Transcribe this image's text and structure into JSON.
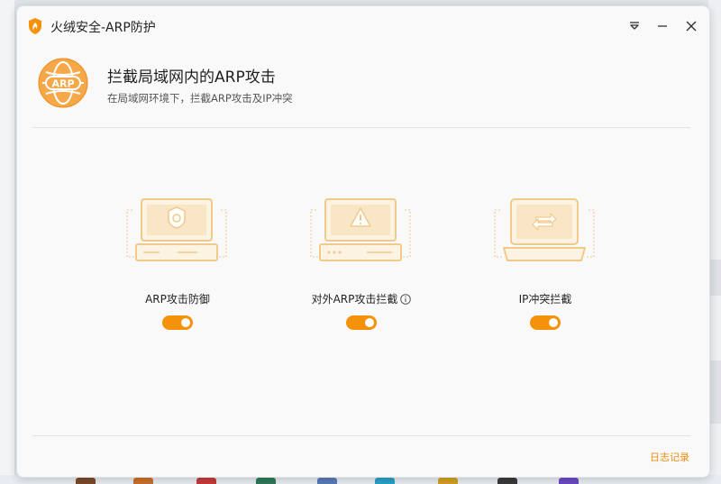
{
  "app": {
    "title": "火绒安全-ARP防护",
    "logo_icon": "huorong-flame-icon"
  },
  "titlebar": {
    "menu_icon": "dropdown-menu-icon",
    "minimize_icon": "minimize-icon",
    "close_icon": "close-icon"
  },
  "header": {
    "icon": "arp-globe-icon",
    "title": "拦截局域网内的ARP攻击",
    "subtitle": "在局域网环境下，拦截ARP攻击及IP冲突"
  },
  "features": [
    {
      "label": "ARP攻击防御",
      "icon": "shield-computer-icon",
      "enabled": true
    },
    {
      "label": "对外ARP攻击拦截",
      "icon": "warning-computer-icon",
      "enabled": true,
      "info_icon": "info-icon"
    },
    {
      "label": "IP冲突拦截",
      "icon": "swap-laptop-icon",
      "enabled": true
    }
  ],
  "footer": {
    "log_link": "日志记录"
  },
  "colors": {
    "accent": "#f5920c",
    "link": "#f08c12",
    "illustration": "#f1c98a"
  }
}
